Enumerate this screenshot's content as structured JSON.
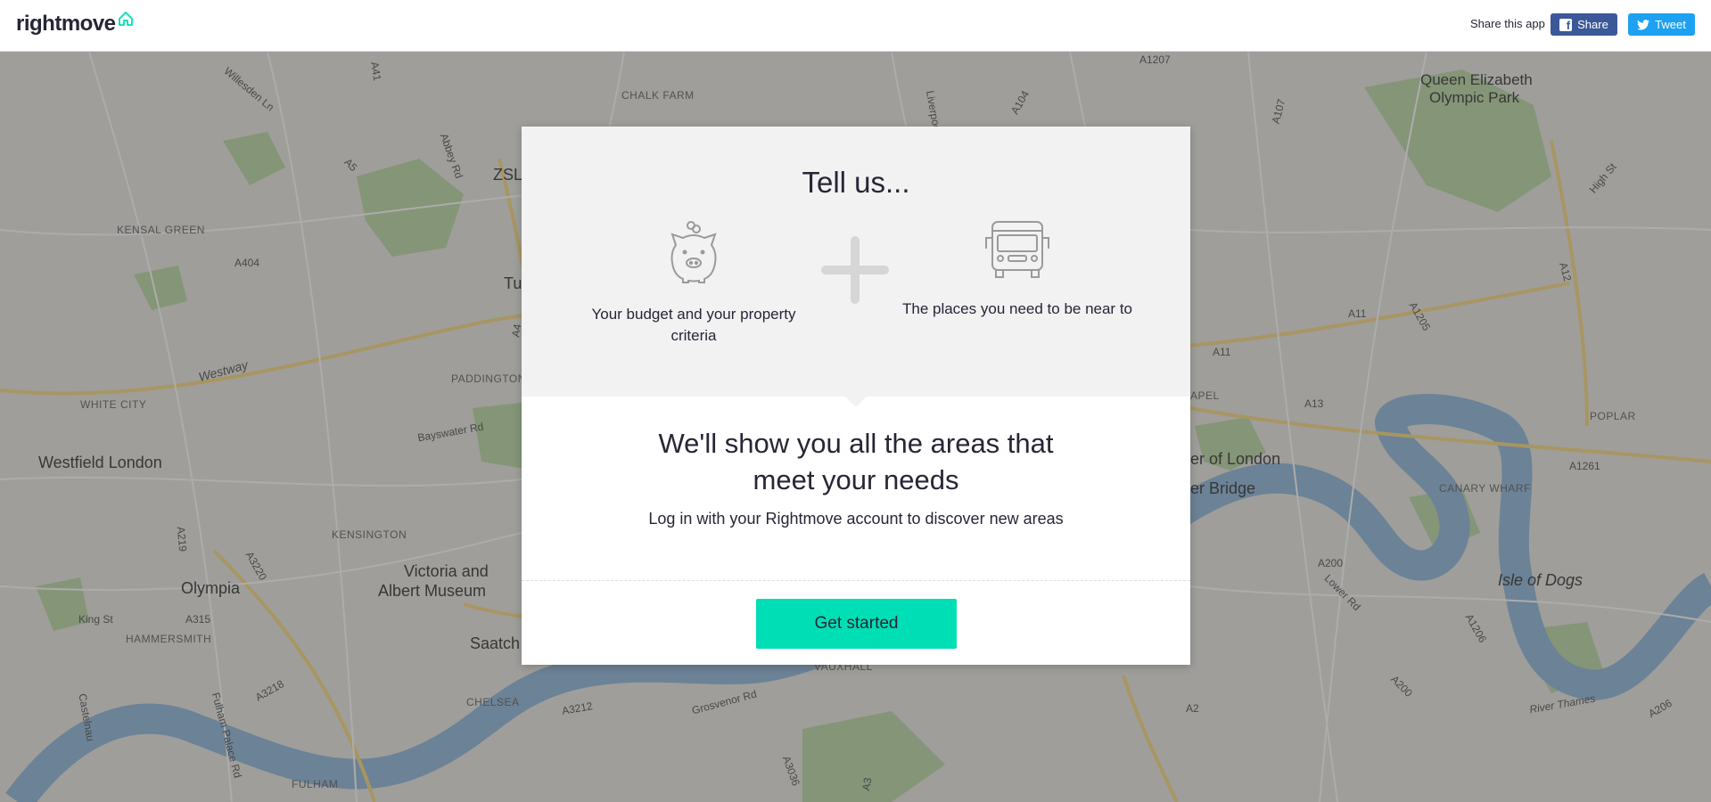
{
  "header": {
    "logo_text": "rightmove",
    "share_label": "Share this app",
    "facebook_button": "Share",
    "twitter_button": "Tweet"
  },
  "modal": {
    "title": "Tell us...",
    "feature_left": "Your budget and your property criteria",
    "feature_right": "The places you need to be near to",
    "headline_line1": "We'll show you all the areas that",
    "headline_line2": "meet your needs",
    "subtitle": "Log in with your Rightmove account to discover new areas",
    "cta": "Get started"
  },
  "map": {
    "labels": {
      "chalk_farm": "CHALK FARM",
      "queen_elizabeth": "Queen Elizabeth",
      "olympic_park": "Olympic Park",
      "kensal_green": "KENSAL GREEN",
      "zsl": "ZSL",
      "westway": "Westway",
      "white_city": "WHITE CITY",
      "paddington": "PADDINGTON",
      "westfield": "Westfield London",
      "kensington": "KENSINGTON",
      "victoria_albert_1": "Victoria and",
      "victoria_albert_2": "Albert Museum",
      "olympia": "Olympia",
      "hammersmith": "HAMMERSMITH",
      "saatchi": "Saatch",
      "chelsea": "CHELSEA",
      "fulham": "FULHAM",
      "vauxhall": "VAUXHALL",
      "grosvenor": "Grosvenor Rd",
      "tower_of_london": "er of London",
      "tower_bridge": "er Bridge",
      "canary_wharf": "CANARY WHARF",
      "poplar": "POPLAR",
      "isle_of_dogs": "Isle of Dogs",
      "river_thames": "River Thames",
      "bayswater": "Bayswater Rd",
      "king_st": "King St",
      "a4": "A4",
      "a404": "A404",
      "a11": "A11",
      "a13": "A13",
      "a12": "A12",
      "a1261": "A1261",
      "a200": "A200",
      "a3212": "A3212",
      "a3220": "A3220",
      "a315": "A315",
      "a2": "A2",
      "a104": "A104",
      "a1207": "A1207",
      "a107": "A107",
      "a1205": "A1205",
      "high_st": "High St",
      "lower_rd": "Lower Rd",
      "a1206": "A1206",
      "a206": "A206",
      "abbey_rd": "Abbey Rd",
      "liverpool_rd": "Liverpool Rd",
      "willesden_ln": "Willesden Ln",
      "tu": "Tu",
      "a5": "A5",
      "a41": "A41",
      "a219": "A219",
      "a3218": "A3218",
      "fulham_palace": "Fulham Palace Rd",
      "castelnau": "Castelnau",
      "a3036": "A3036",
      "a3": "A3",
      "apel": "APEL"
    }
  },
  "colors": {
    "accent": "#00deb6",
    "text": "#262637",
    "facebook": "#3b5998",
    "twitter": "#1da1f2",
    "logo_house": "#00deb6"
  },
  "icons": {
    "logo": "house-outline-icon",
    "feature_left": "piggy-bank-icon",
    "plus": "plus-icon",
    "feature_right": "bus-icon",
    "facebook": "facebook-icon",
    "twitter": "twitter-bird-icon"
  }
}
